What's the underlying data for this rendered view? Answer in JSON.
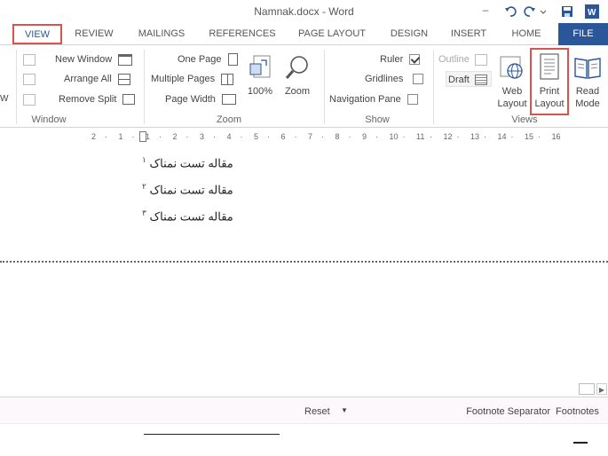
{
  "titlebar": {
    "title": "Namnak.docx - Word",
    "minimize": "–"
  },
  "tabs": [
    {
      "id": "file",
      "label": "FILE"
    },
    {
      "id": "home",
      "label": "HOME"
    },
    {
      "id": "insert",
      "label": "INSERT"
    },
    {
      "id": "design",
      "label": "DESIGN"
    },
    {
      "id": "page_layout",
      "label": "PAGE LAYOUT"
    },
    {
      "id": "references",
      "label": "REFERENCES"
    },
    {
      "id": "mailings",
      "label": "MAILINGS"
    },
    {
      "id": "review",
      "label": "REVIEW"
    },
    {
      "id": "view",
      "label": "VIEW"
    }
  ],
  "ribbon": {
    "views": {
      "group_label": "Views",
      "read_mode": "Read Mode",
      "print_layout": "Print Layout",
      "web_layout": "Web Layout",
      "outline": "Outline",
      "draft": "Draft"
    },
    "show": {
      "group_label": "Show",
      "ruler": "Ruler",
      "gridlines": "Gridlines",
      "navigation_pane": "Navigation Pane",
      "ruler_checked": true,
      "gridlines_checked": false,
      "navigation_pane_checked": false
    },
    "zoom": {
      "group_label": "Zoom",
      "zoom": "Zoom",
      "hundred": "100%",
      "one_page": "One Page",
      "multiple_pages": "Multiple Pages",
      "page_width": "Page Width"
    },
    "window": {
      "group_label": "Window",
      "new_window": "New Window",
      "arrange_all": "Arrange All",
      "remove_split": "Remove Split",
      "cut_label": "W"
    }
  },
  "ruler": {
    "numbers": [
      "2",
      "1",
      "1",
      "2",
      "3",
      "4",
      "5",
      "6",
      "7",
      "8",
      "9",
      "10",
      "11",
      "12",
      "13",
      "14",
      "15",
      "16"
    ]
  },
  "document": {
    "lines": [
      {
        "num": "۱",
        "text": "ﻣﻘﺎﻟﻪ ﺗﺴﺖ ﻧﻤﻨﺎک"
      },
      {
        "num": "۲",
        "text": "ﻣﻘﺎﻟﻪ ﺗﺴﺖ ﻧﻤﻨﺎک"
      },
      {
        "num": "۳",
        "text": "ﻣﻘﺎﻟﻪ ﺗﺴﺖ ﻧﻤﻨﺎک"
      }
    ]
  },
  "footnotes": {
    "label": "Footnotes",
    "selected": "Footnote Separator",
    "reset": "Reset"
  },
  "colors": {
    "accent": "#2b579a",
    "highlight": "#d9534f"
  }
}
